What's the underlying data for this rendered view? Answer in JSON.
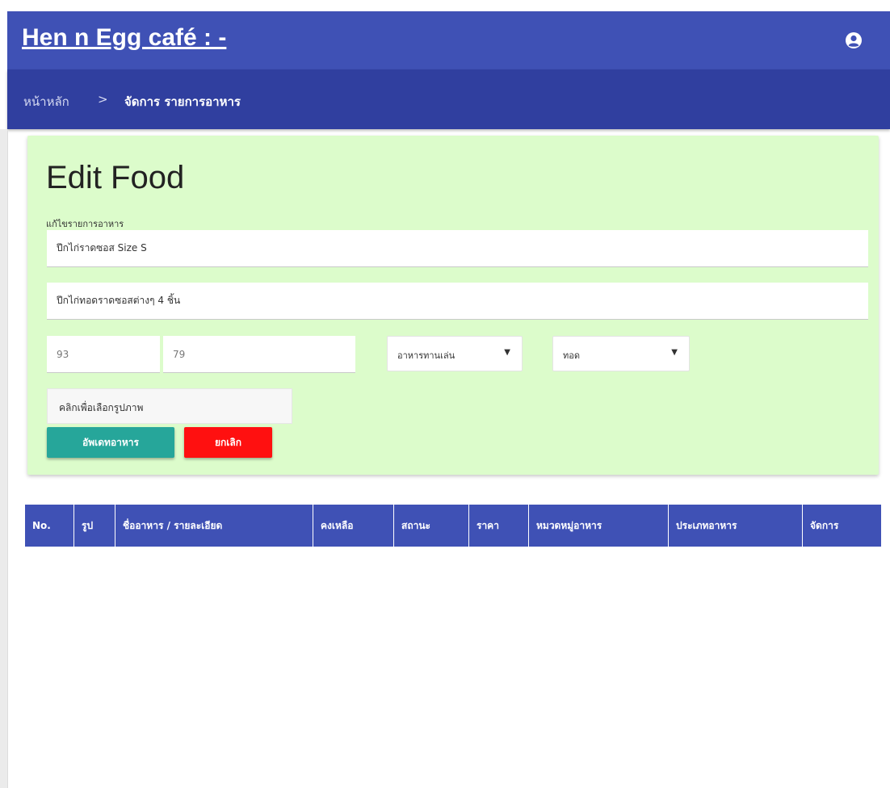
{
  "header": {
    "brand": "Hen n Egg café : -",
    "user_icon": "user-circle-icon"
  },
  "breadcrumb": {
    "home": "หน้าหลัก",
    "separator": ">",
    "current": "จัดการ รายการอาหาร"
  },
  "form": {
    "title": "Edit Food",
    "caption": "แก้ไขรายการอาหาร",
    "name_value": "ปีกไก่ราดซอส Size S",
    "description_value": "ปีกไก่ทอดราดซอสต่างๆ 4 ชิ้น",
    "stock_value": "93",
    "price_value": "79",
    "category_selected": "อาหารทานเล่น",
    "type_selected": "ทอด",
    "image_picker_label": "คลิกเพื่อเลือกรูปภาพ",
    "update_label": "อัพเดทอาหาร",
    "cancel_label": "ยกเลิก"
  },
  "table": {
    "headers": [
      "No.",
      "รูป",
      "ชื่ออาหาร / รายละเอียด",
      "คงเหลือ",
      "สถานะ",
      "ราคา",
      "หมวดหมู่อาหาร",
      "ประเภทอาหาร",
      "จัดการ"
    ]
  },
  "colors": {
    "header": "#3f51b5",
    "breadcrumb": "#303f9f",
    "card": "#dcfccb",
    "update_button": "#26a69a",
    "cancel_button": "#ff1010"
  }
}
